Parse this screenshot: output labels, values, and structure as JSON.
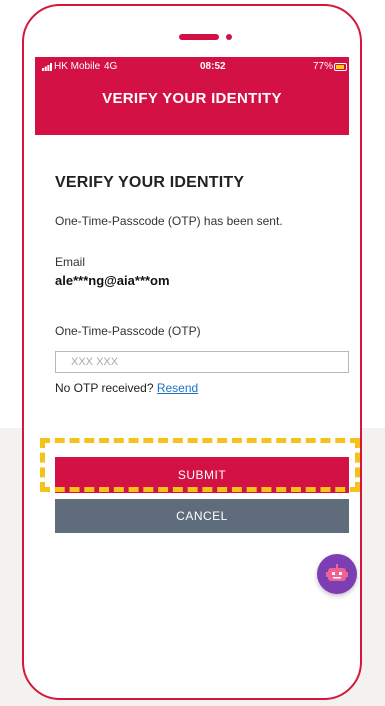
{
  "status_bar": {
    "carrier": "HK Mobile",
    "network": "4G",
    "time": "08:52",
    "battery": "77%"
  },
  "header": {
    "title": "VERIFY YOUR IDENTITY"
  },
  "main": {
    "title": "VERIFY YOUR IDENTITY",
    "otp_sent_message": "One-Time-Passcode (OTP) has been sent.",
    "email_label": "Email",
    "email_value": "ale***ng@aia***om",
    "otp_label": "One-Time-Passcode (OTP)",
    "otp_input_value": "",
    "otp_placeholder": "XXX XXX",
    "no_otp_text": "No OTP received?",
    "resend_label": "Resend",
    "submit_label": "SUBMIT",
    "cancel_label": "CANCEL"
  },
  "icons": {
    "signal": "signal-bars-icon",
    "battery": "battery-icon",
    "chatbot": "chatbot-icon"
  },
  "colors": {
    "brand_red": "#d31145",
    "cancel_gray": "#5e6c7b",
    "highlight_yellow": "#f4c21b",
    "link_blue": "#1a73c9",
    "chatbot_purple": "#7c3fb3"
  }
}
